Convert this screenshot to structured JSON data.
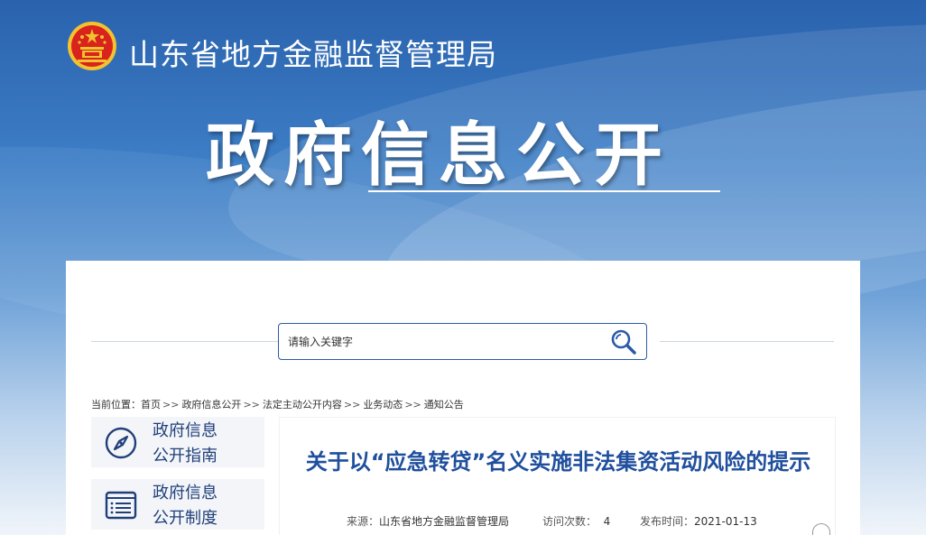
{
  "colors": {
    "banner_blue": "#2a62ad",
    "title_blue": "#1f4f9d",
    "nav_blue": "#1f3f7a",
    "search_border": "#2a5aa8",
    "emblem_red": "#d8241c",
    "emblem_gold": "#f2c230"
  },
  "header": {
    "site_title": "山东省地方金融监督管理局",
    "hero_title": "政府信息公开",
    "emblem_icon": "national-emblem-icon"
  },
  "search": {
    "placeholder": "请输入关键字",
    "icon": "search-icon"
  },
  "breadcrumb": {
    "label": "当前位置：",
    "items": [
      "首页",
      "政府信息公开",
      "法定主动公开内容",
      "业务动态",
      "通知公告"
    ],
    "separator": ">>"
  },
  "sidebar": {
    "items": [
      {
        "line1": "政府信息",
        "line2": "公开指南",
        "icon": "compass-icon"
      },
      {
        "line1": "政府信息",
        "line2": "公开制度",
        "icon": "document-list-icon"
      }
    ]
  },
  "article": {
    "title": "关于以“应急转贷”名义实施非法集资活动风险的提示",
    "source_label": "来源：",
    "source_value": "山东省地方金融监督管理局",
    "visits_label": "访问次数：",
    "visits_value": "4",
    "date_label": "发布时间：",
    "date_value": "2021-01-13"
  }
}
